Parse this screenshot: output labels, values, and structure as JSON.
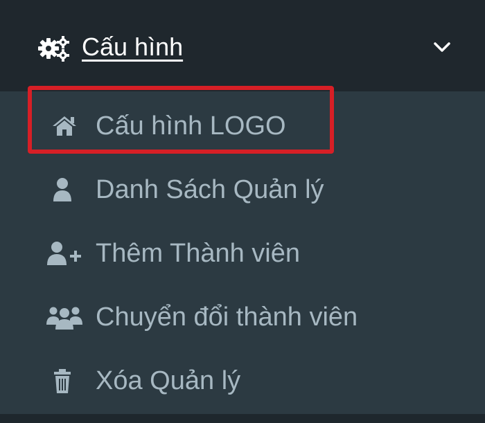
{
  "header": {
    "label": "Cấu hình",
    "icon": "gears-icon",
    "toggle_icon": "chevron-down-icon"
  },
  "submenu": {
    "items": [
      {
        "label": "Cấu hình LOGO",
        "icon": "home-icon",
        "highlighted": true
      },
      {
        "label": "Danh Sách Quản lý",
        "icon": "user-icon"
      },
      {
        "label": "Thêm Thành viên",
        "icon": "user-plus-icon"
      },
      {
        "label": "Chuyển đổi thành viên",
        "icon": "users-icon"
      },
      {
        "label": "Xóa Quản lý",
        "icon": "trash-icon"
      }
    ]
  },
  "colors": {
    "header_bg": "#1f272d",
    "submenu_bg": "#2c3a42",
    "header_text": "#ffffff",
    "item_text": "#a7b8c2",
    "highlight": "#d71f26"
  }
}
